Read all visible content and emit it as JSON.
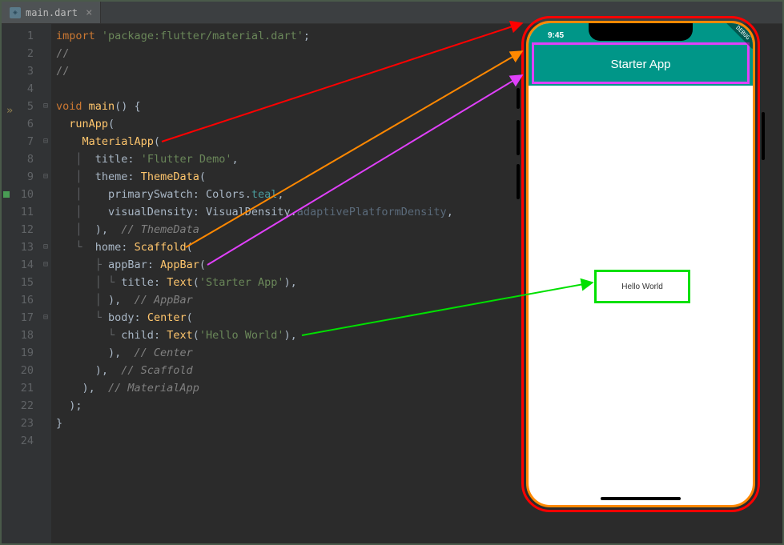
{
  "tab": {
    "filename": "main.dart",
    "close_symbol": "×"
  },
  "lines": [
    {
      "n": 1,
      "html": "<span class='kw'>import</span> <span class='str'>'package:flutter/material.dart'</span>;"
    },
    {
      "n": 2,
      "html": "<span class='com2'>//</span>"
    },
    {
      "n": 3,
      "html": "<span class='com2'>//</span>"
    },
    {
      "n": 4,
      "html": ""
    },
    {
      "n": 5,
      "html": "<span class='kw'>void</span> <span class='fn'>main</span>() {"
    },
    {
      "n": 6,
      "html": "  <span class='fn'>runApp</span>("
    },
    {
      "n": 7,
      "html": "    <span class='cls'>MaterialApp</span>("
    },
    {
      "n": 8,
      "html": "   <span class='tree'>│</span>  title: <span class='str'>'Flutter Demo'</span>,"
    },
    {
      "n": 9,
      "html": "   <span class='tree'>│</span>  theme: <span class='cls'>ThemeData</span>("
    },
    {
      "n": 10,
      "html": "   <span class='tree'>│</span>    primarySwatch: Colors.<span class='teal'>teal</span>,"
    },
    {
      "n": 11,
      "html": "   <span class='tree'>│</span>    visualDensity: VisualDensity.<span class='dim'>adaptivePlatformDensity</span>,"
    },
    {
      "n": 12,
      "html": "   <span class='tree'>│</span>  ),  <span class='com'>// ThemeData</span>"
    },
    {
      "n": 13,
      "html": "   <span class='tree'>└</span>  home: <span class='cls'>Scaffold</span>("
    },
    {
      "n": 14,
      "html": "      <span class='tree'>├</span> appBar: <span class='cls'>AppBar</span>("
    },
    {
      "n": 15,
      "html": "      <span class='tree'>│ └</span> title: <span class='cls'>Text</span>(<span class='str'>'Starter App'</span>),"
    },
    {
      "n": 16,
      "html": "      <span class='tree'>│</span> ),  <span class='com'>// AppBar</span>"
    },
    {
      "n": 17,
      "html": "      <span class='tree'>└</span> body: <span class='cls'>Center</span>("
    },
    {
      "n": 18,
      "html": "        <span class='tree'>└</span> child: <span class='cls'>Text</span>(<span class='str'>'Hello World'</span>),"
    },
    {
      "n": 19,
      "html": "        ),  <span class='com'>// Center</span>"
    },
    {
      "n": 20,
      "html": "      ),  <span class='com'>// Scaffold</span>"
    },
    {
      "n": 21,
      "html": "    ),  <span class='com'>// MaterialApp</span>"
    },
    {
      "n": 22,
      "html": "  );"
    },
    {
      "n": 23,
      "html": "}"
    },
    {
      "n": 24,
      "html": ""
    }
  ],
  "phone": {
    "status_time": "9:45",
    "appbar_title": "Starter App",
    "body_text": "Hello World",
    "debug_label": "DEBUG"
  },
  "annotation_colors": {
    "material_app": "#ff0000",
    "scaffold": "#ff8800",
    "appbar": "#e040fb",
    "text": "#00e000"
  }
}
